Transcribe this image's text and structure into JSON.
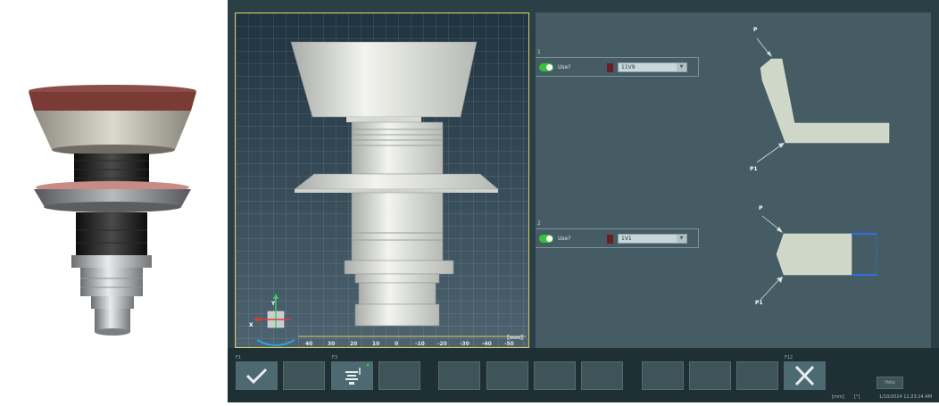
{
  "view3d": {
    "axis_x_label": "X",
    "axis_y_label": "Y",
    "unit_label": "[mm]",
    "scale_ticks": [
      "40",
      "30",
      "20",
      "10",
      "0",
      "-10",
      "-20",
      "-30",
      "-40",
      "-50"
    ]
  },
  "tools": [
    {
      "number": "1",
      "use_label": "Use?",
      "enabled": true,
      "selected_profile": "11V9",
      "callout_top": "P",
      "callout_bottom": "P1"
    },
    {
      "number": "2",
      "use_label": "Use?",
      "enabled": true,
      "selected_profile": "1V1",
      "callout_top": "P",
      "callout_bottom": "P1"
    }
  ],
  "toolbar": {
    "f1_label": "F1",
    "f3_label": "F3",
    "f12_label": "F12",
    "confirm_icon": "checkmark-icon",
    "f3_icon": "wheel-stack-icon",
    "cancel_icon": "close-icon",
    "help_label": "Help"
  },
  "status": {
    "unit": "[mm]",
    "angle_unit": "[°]",
    "datetime": "1/10/2024   11:23:14 AM"
  },
  "colors": {
    "toggle_on": "#37c23b",
    "frame_highlight": "#d8cf62",
    "axis_x": "#e23b2e",
    "axis_y": "#3ad15a"
  }
}
